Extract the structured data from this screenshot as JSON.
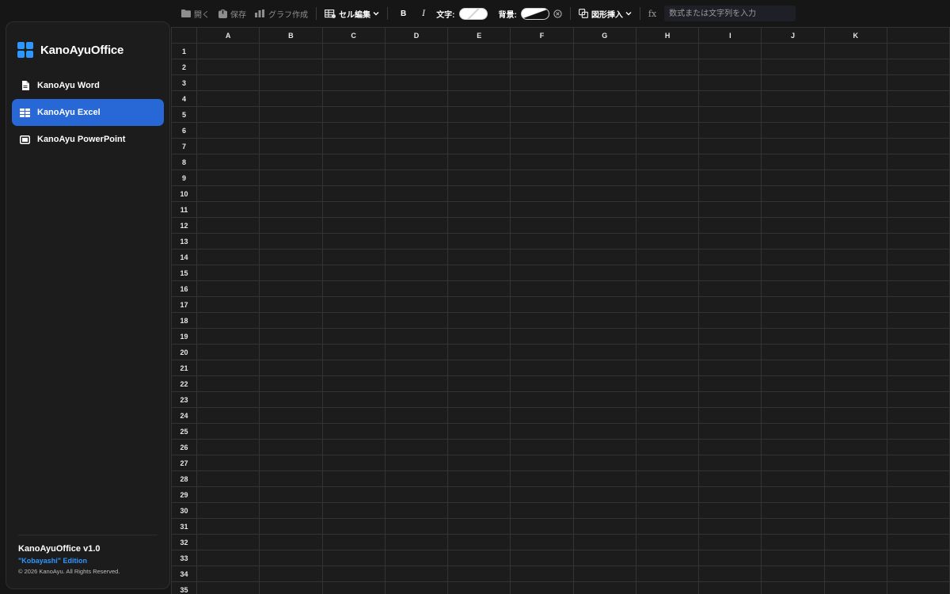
{
  "app": {
    "name": "KanoAyuOffice",
    "version_label": "KanoAyuOffice v1.0",
    "edition_label": "\"Kobayashi\" Edition",
    "copyright": "© 2026 KanoAyu. All Rights Reserved."
  },
  "sidebar": {
    "items": [
      {
        "label": "KanoAyu Word",
        "icon": "document-icon",
        "active": false
      },
      {
        "label": "KanoAyu Excel",
        "icon": "spreadsheet-icon",
        "active": true
      },
      {
        "label": "KanoAyu PowerPoint",
        "icon": "presentation-icon",
        "active": false
      }
    ]
  },
  "toolbar": {
    "open_label": "開く",
    "save_label": "保存",
    "chart_label": "グラフ作成",
    "cell_edit_label": "セル編集",
    "bold_label": "B",
    "italic_label": "I",
    "text_color_label": "文字:",
    "bg_color_label": "背景:",
    "shape_insert_label": "図形挿入",
    "fx_label": "fx",
    "formula_placeholder": "数式または文字列を入力"
  },
  "sheet": {
    "columns": [
      "A",
      "B",
      "C",
      "D",
      "E",
      "F",
      "G",
      "H",
      "I",
      "J",
      "K",
      ""
    ],
    "rows": [
      "1",
      "2",
      "3",
      "4",
      "5",
      "6",
      "7",
      "8",
      "9",
      "10",
      "11",
      "12",
      "13",
      "14",
      "15",
      "16",
      "17",
      "18",
      "19",
      "20",
      "21",
      "22",
      "23",
      "24",
      "25",
      "26",
      "27",
      "28",
      "29",
      "30",
      "31",
      "32",
      "33",
      "34",
      "35"
    ]
  },
  "colors": {
    "accent": "#2867d6",
    "brand": "#2e97ff",
    "background": "#161616"
  }
}
